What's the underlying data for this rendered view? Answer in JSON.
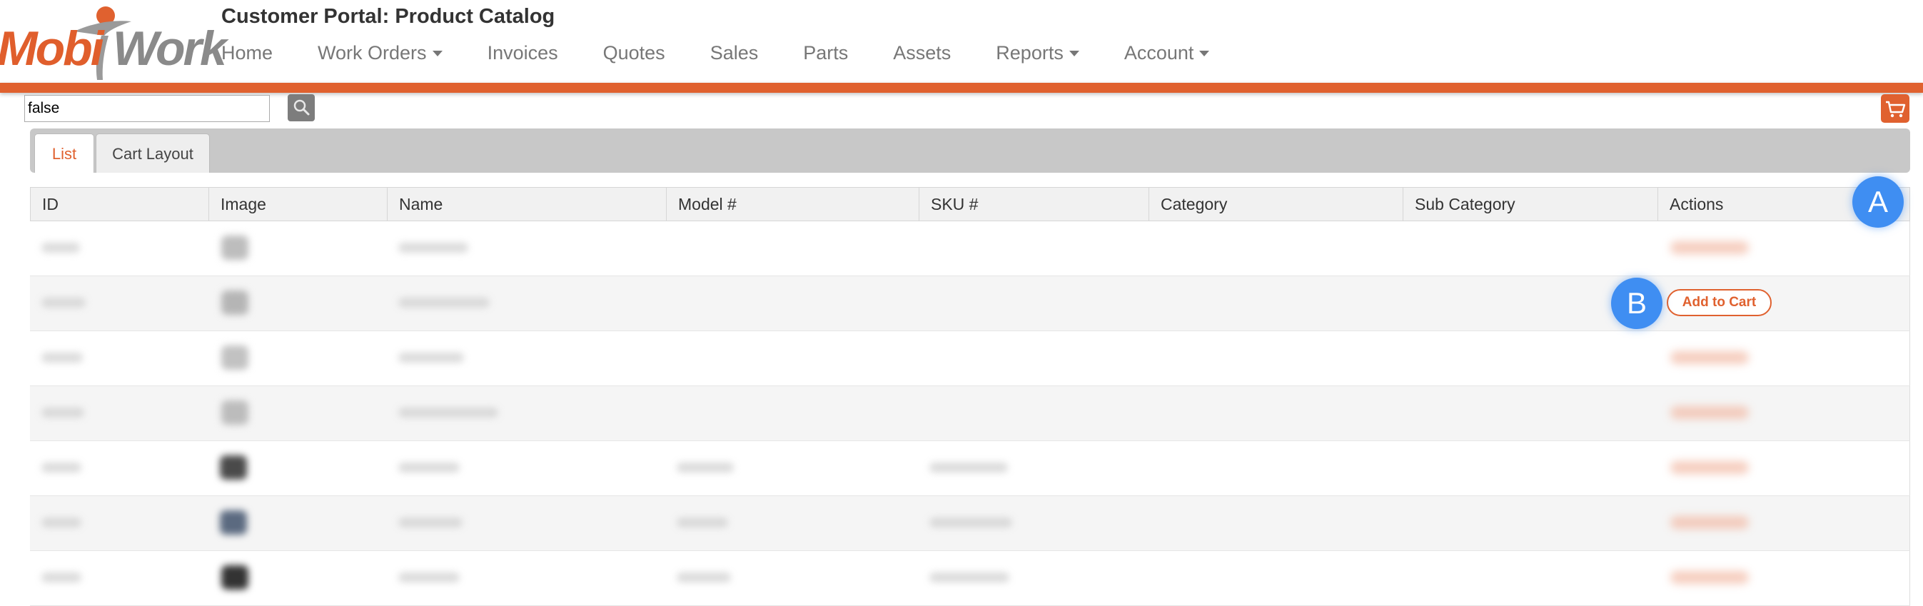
{
  "header": {
    "title": "Customer Portal: Product Catalog",
    "logo": {
      "part1": "Mobi",
      "part2": "Work"
    },
    "nav": [
      {
        "label": "Home",
        "dropdown": false
      },
      {
        "label": "Work Orders",
        "dropdown": true
      },
      {
        "label": "Invoices",
        "dropdown": false
      },
      {
        "label": "Quotes",
        "dropdown": false
      },
      {
        "label": "Sales",
        "dropdown": false
      },
      {
        "label": "Parts",
        "dropdown": false
      },
      {
        "label": "Assets",
        "dropdown": false
      },
      {
        "label": "Reports",
        "dropdown": true
      },
      {
        "label": "Account",
        "dropdown": true
      }
    ]
  },
  "search": {
    "value": "false",
    "icon": "search-icon"
  },
  "cart": {
    "icon": "cart-icon"
  },
  "tabs": [
    {
      "label": "List",
      "active": true
    },
    {
      "label": "Cart Layout",
      "active": false
    }
  ],
  "table": {
    "columns": [
      "ID",
      "Image",
      "Name",
      "Model #",
      "SKU #",
      "Category",
      "Sub Category",
      "Actions"
    ],
    "rows": 7,
    "highlighted_action": "Add to Cart"
  },
  "markers": {
    "a": "A",
    "b": "B"
  },
  "colors": {
    "accent": "#e0612f",
    "marker": "#3f8ef2",
    "tab_bar": "#c8c8c8"
  }
}
